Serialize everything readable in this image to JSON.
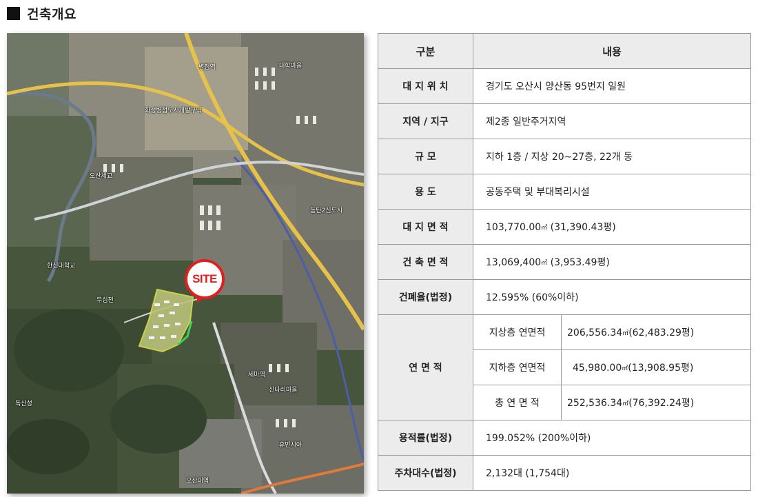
{
  "section": {
    "title": "건축개요"
  },
  "map": {
    "site_label": "SITE",
    "labels": {
      "l1": "병점역",
      "l2": "대학마을",
      "l3": "화성병점도시개발구역",
      "l4": "동탄2신도시",
      "l5": "한신대학교",
      "l6": "독산성",
      "l7": "오산세교",
      "l8": "세마역",
      "l9": "무심천",
      "l10": "신나리마을",
      "l11": "휴먼시아",
      "l12": "오산대역"
    }
  },
  "table": {
    "header": {
      "col1": "구분",
      "col2": "내용"
    },
    "rows": {
      "site": {
        "key": "대 지 위 치",
        "value": "경기도 오산시 양산동 95번지 일원"
      },
      "zone": {
        "key": "지역 / 지구",
        "value": "제2종 일반주거지역"
      },
      "scale": {
        "key": "규 모",
        "value": "지하 1층 / 지상 20~27층, 22개 동"
      },
      "use": {
        "key": "용 도",
        "value": "공동주택 및 부대복리시설"
      },
      "land_area": {
        "key": "대 지 면 적",
        "value": "103,770.00",
        "unit": "㎡",
        "extra": "(31,390.43평)"
      },
      "building_area": {
        "key": "건 축 면 적",
        "value": "13,069,400",
        "unit": "㎡",
        "extra": "(3,953.49평)"
      },
      "coverage": {
        "key": "건폐율(법정)",
        "value": "12.595% (60%이하)"
      },
      "floor_area": {
        "key": "연 면 적",
        "sub": {
          "above": {
            "key": "지상층 연면적",
            "value": "206,556.34",
            "unit": "㎡",
            "extra": "(62,483.29평)"
          },
          "below": {
            "key": "지하층 연면적",
            "value": "45,980.00",
            "unit": "㎡",
            "extra": "(13,908.95평)"
          },
          "total": {
            "key": "총 연 면 적",
            "value": "252,536.34",
            "unit": "㎡",
            "extra": "(76,392.24평)"
          }
        }
      },
      "far": {
        "key": "용적률(법정)",
        "value": "199.052% (200%이하)"
      },
      "parking": {
        "key": "주차대수(법정)",
        "value": "2,132대 (1,754대)"
      }
    }
  }
}
